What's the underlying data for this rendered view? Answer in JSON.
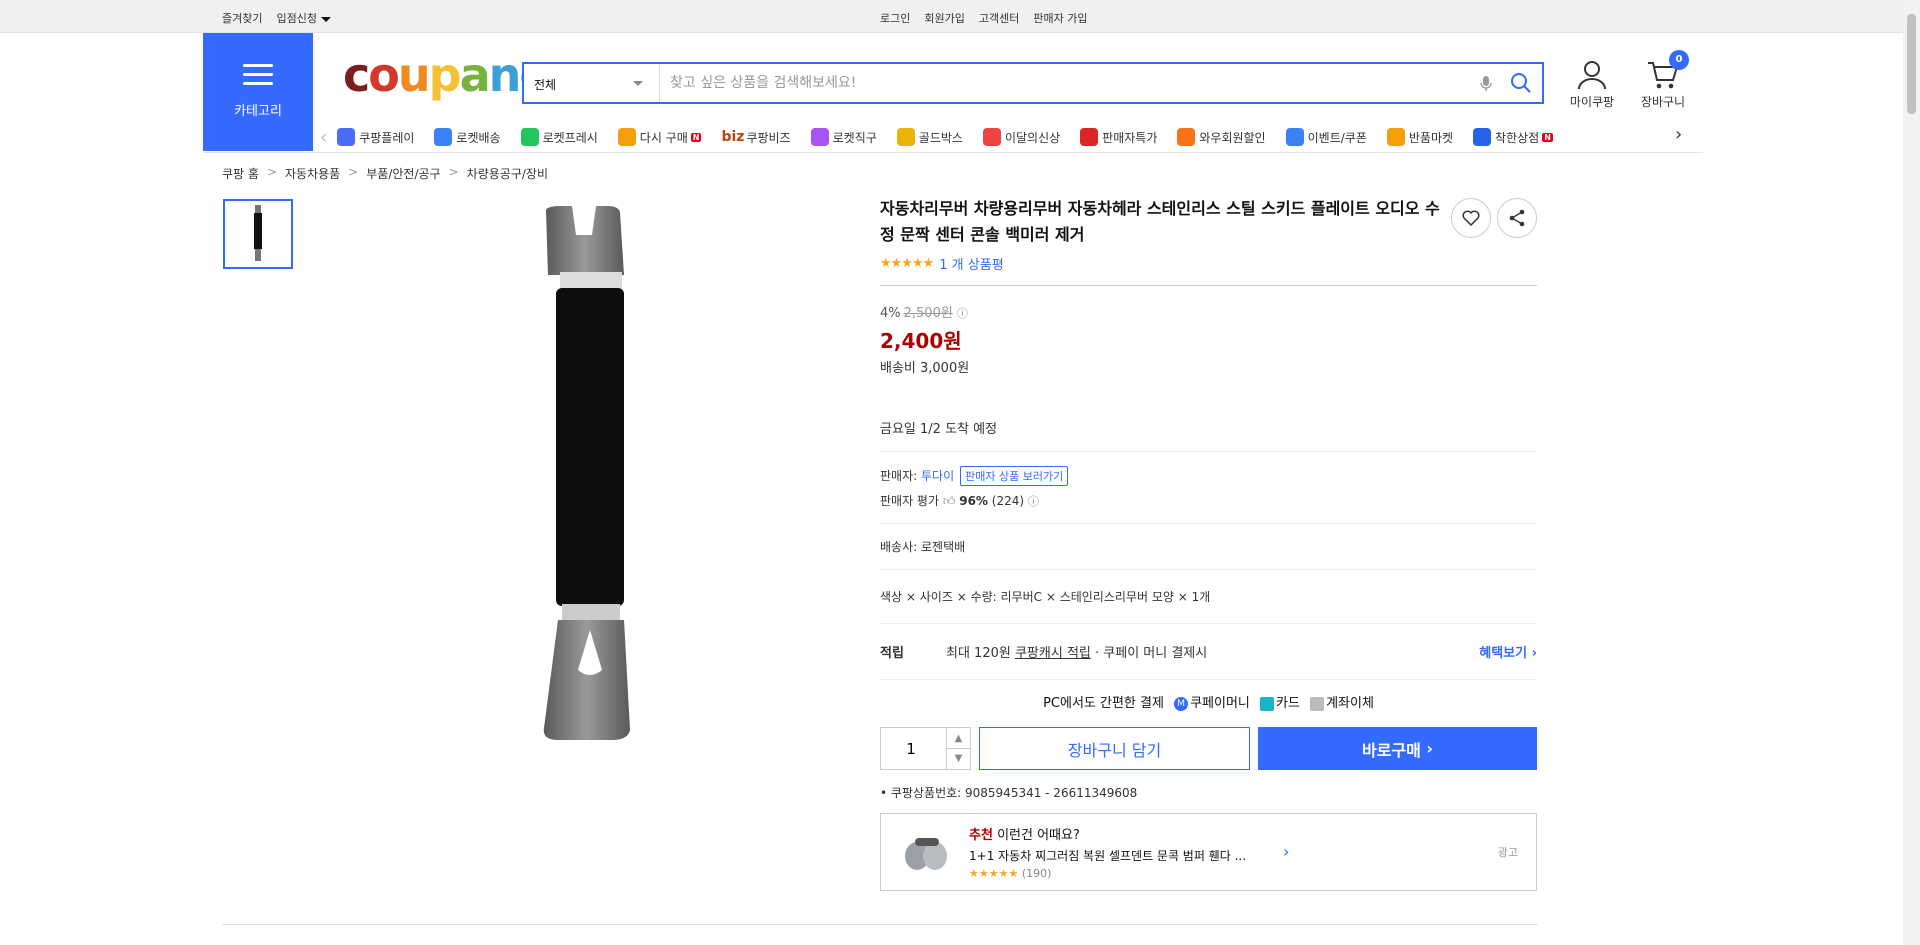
{
  "topbar": {
    "bookmark": "즐겨찾기",
    "partner": "입점신청",
    "login": "로그인",
    "signup": "회원가입",
    "cs": "고객센터",
    "seller_signup": "판매자 가입"
  },
  "category": {
    "label": "카테고리"
  },
  "logo": {
    "text": "coupang",
    "colors": [
      "#7a1f1f",
      "#d4372c",
      "#ef8a1f",
      "#f5c033",
      "#77b43f",
      "#3ba0d8",
      "#2b77c9"
    ]
  },
  "search": {
    "category": "전체",
    "placeholder": "찾고 싶은 상품을 검색해보세요!"
  },
  "user": {
    "mycoupang": "마이쿠팡",
    "cart": "장바구니",
    "cart_count": "0"
  },
  "nav": {
    "items": [
      {
        "label": "쿠팡플레이",
        "color": "#4a6cf7"
      },
      {
        "label": "로켓배송",
        "color": "#3b82f6"
      },
      {
        "label": "로켓프레시",
        "color": "#22c55e"
      },
      {
        "label": "다시 구매",
        "color": "#f59e0b",
        "badge": "N"
      },
      {
        "label": "쿠팡비즈",
        "prefix": "biz",
        "color": "#c2410c"
      },
      {
        "label": "로켓직구",
        "color": "#a855f7"
      },
      {
        "label": "골드박스",
        "color": "#eab308"
      },
      {
        "label": "이달의신상",
        "color": "#ef4444"
      },
      {
        "label": "판매자특가",
        "color": "#dc2626"
      },
      {
        "label": "와우회원할인",
        "color": "#f97316"
      },
      {
        "label": "이벤트/쿠폰",
        "color": "#3b82f6"
      },
      {
        "label": "반품마켓",
        "color": "#f59e0b"
      },
      {
        "label": "착한상점",
        "color": "#2563eb",
        "badge": "N"
      }
    ]
  },
  "breadcrumb": [
    "쿠팡 홈",
    "자동차용품",
    "부품/안전/공구",
    "차량용공구/장비"
  ],
  "product": {
    "title": "자동차리무버 차량용리무버 자동차헤라 스테인리스 스틸 스키드 플레이트 오디오 수정 문짝 센터 콘솔 백미러 제거",
    "rating_stars": "★★★★★",
    "reviews": "1 개 상품평",
    "discount_rate": "4%",
    "original_price": "2,500원",
    "price": "2,400원",
    "shipping_fee": "배송비 3,000원",
    "arrival": "금요일 1/2 도착 예정",
    "seller_label": "판매자:",
    "seller_name": "투다이",
    "seller_link": "판매자 상품 보러가기",
    "seller_rating_label": "판매자 평가",
    "seller_rating": "96%",
    "seller_rating_count": "(224)",
    "courier_label": "배송사:",
    "courier": "로젠택배",
    "options": "색상 × 사이즈 × 수량: 리무버C × 스테인리스리무버 모양 × 1개",
    "benefit_title": "적립",
    "benefit_text": "최대 120원",
    "benefit_link": "쿠팡캐시 적립",
    "benefit_tail": "· 쿠페이 머니 결제시",
    "benefit_more": "혜택보기",
    "pay_title": "PC에서도 간편한 결제",
    "pay_methods": [
      "쿠페이머니",
      "카드",
      "계좌이체"
    ],
    "qty": "1",
    "add_cart": "장바구니 담기",
    "buy_now": "바로구매",
    "product_id": "쿠팡상품번호: 9085945341 - 26611349608"
  },
  "reco": {
    "head_red": "추천",
    "head": "이런건 어때요?",
    "name": "1+1 자동차 찌그러짐 복원 셀프덴트 문콕 범퍼 휀다 ...",
    "stars": "★★★★★",
    "count": "(190)",
    "ad": "광고"
  }
}
